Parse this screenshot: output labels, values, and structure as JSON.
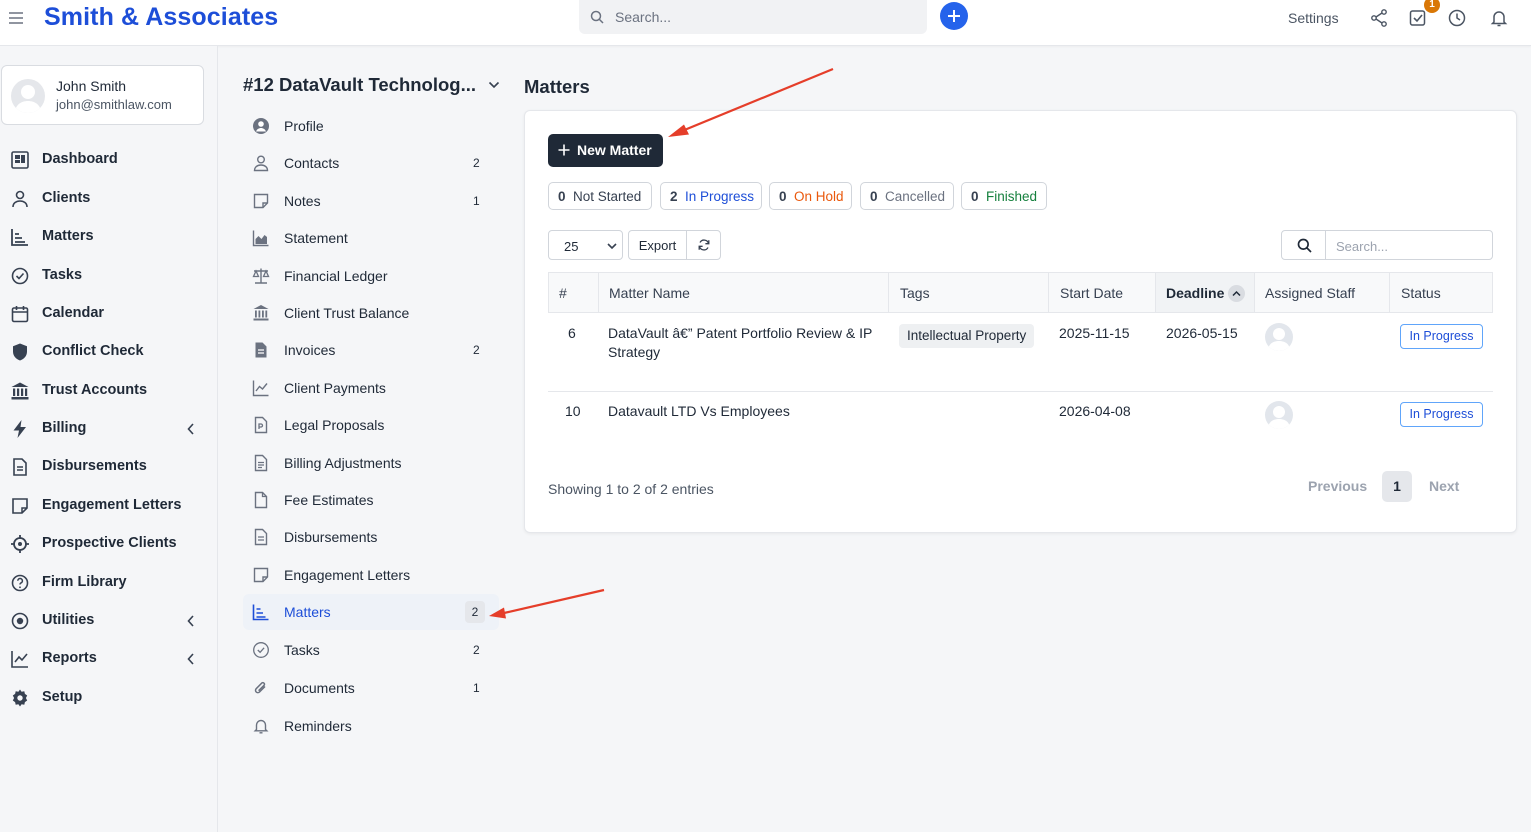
{
  "app": {
    "brand": "Smith & Associates"
  },
  "topbar": {
    "search_placeholder": "Search...",
    "settings_label": "Settings",
    "notification_badge": "1"
  },
  "user": {
    "name": "John Smith",
    "email": "john@smithlaw.com"
  },
  "sidebar": {
    "items": [
      {
        "label": "Dashboard",
        "icon": "dashboard-icon"
      },
      {
        "label": "Clients",
        "icon": "user-icon"
      },
      {
        "label": "Matters",
        "icon": "matters-icon"
      },
      {
        "label": "Tasks",
        "icon": "check-circle-icon"
      },
      {
        "label": "Calendar",
        "icon": "calendar-icon"
      },
      {
        "label": "Conflict Check",
        "icon": "shield-icon"
      },
      {
        "label": "Trust Accounts",
        "icon": "bank-icon"
      },
      {
        "label": "Billing",
        "icon": "bolt-icon",
        "expandable": true
      },
      {
        "label": "Disbursements",
        "icon": "document-icon"
      },
      {
        "label": "Engagement Letters",
        "icon": "note-icon"
      },
      {
        "label": "Prospective Clients",
        "icon": "crosshair-icon"
      },
      {
        "label": "Firm Library",
        "icon": "help-circle-icon"
      },
      {
        "label": "Utilities",
        "icon": "radio-icon",
        "expandable": true
      },
      {
        "label": "Reports",
        "icon": "chart-line-icon",
        "expandable": true
      },
      {
        "label": "Setup",
        "icon": "gear-icon"
      }
    ]
  },
  "client": {
    "title": "#12 DataVault Technolog...",
    "menu": [
      {
        "label": "Profile",
        "count": ""
      },
      {
        "label": "Contacts",
        "count": "2"
      },
      {
        "label": "Notes",
        "count": "1"
      },
      {
        "label": "Statement",
        "count": ""
      },
      {
        "label": "Financial Ledger",
        "count": ""
      },
      {
        "label": "Client Trust Balance",
        "count": ""
      },
      {
        "label": "Invoices",
        "count": "2"
      },
      {
        "label": "Client Payments",
        "count": ""
      },
      {
        "label": "Legal Proposals",
        "count": ""
      },
      {
        "label": "Billing Adjustments",
        "count": ""
      },
      {
        "label": "Fee Estimates",
        "count": ""
      },
      {
        "label": "Disbursements",
        "count": ""
      },
      {
        "label": "Engagement Letters",
        "count": ""
      },
      {
        "label": "Matters",
        "count": "2",
        "active": true
      },
      {
        "label": "Tasks",
        "count": "2"
      },
      {
        "label": "Documents",
        "count": "1"
      },
      {
        "label": "Reminders",
        "count": ""
      }
    ]
  },
  "main": {
    "title": "Matters",
    "new_button": "New Matter",
    "status_filters": [
      {
        "count": "0",
        "label": "Not Started",
        "color": "#374151"
      },
      {
        "count": "2",
        "label": "In Progress",
        "color": "#1d4ed8"
      },
      {
        "count": "0",
        "label": "On Hold",
        "color": "#ea580c"
      },
      {
        "count": "0",
        "label": "Cancelled",
        "color": "#6b7280"
      },
      {
        "count": "0",
        "label": "Finished",
        "color": "#15803d"
      }
    ],
    "page_length": "25",
    "export_label": "Export",
    "table_search_placeholder": "Search...",
    "columns": [
      "#",
      "Matter Name",
      "Tags",
      "Start Date",
      "Deadline",
      "Assigned Staff",
      "Status"
    ],
    "rows": [
      {
        "id": "6",
        "name_line1": "DataVault â€” Patent Portfolio Review & IP",
        "name_line2": "Strategy",
        "tag": "Intellectual Property",
        "start_date": "2025-11-15",
        "deadline": "2026-05-15",
        "status": "In Progress"
      },
      {
        "id": "10",
        "name_line1": "Datavault LTD Vs Employees",
        "name_line2": "",
        "tag": "",
        "start_date": "2026-04-08",
        "deadline": "",
        "status": "In Progress"
      }
    ],
    "showing_text": "Showing 1 to 2 of 2 entries",
    "pagination": {
      "previous": "Previous",
      "current": "1",
      "next": "Next"
    }
  },
  "colors": {
    "brand": "#1d4ed8",
    "primary_button": "#1f2937",
    "annotation_arrow": "#e53e2a"
  }
}
